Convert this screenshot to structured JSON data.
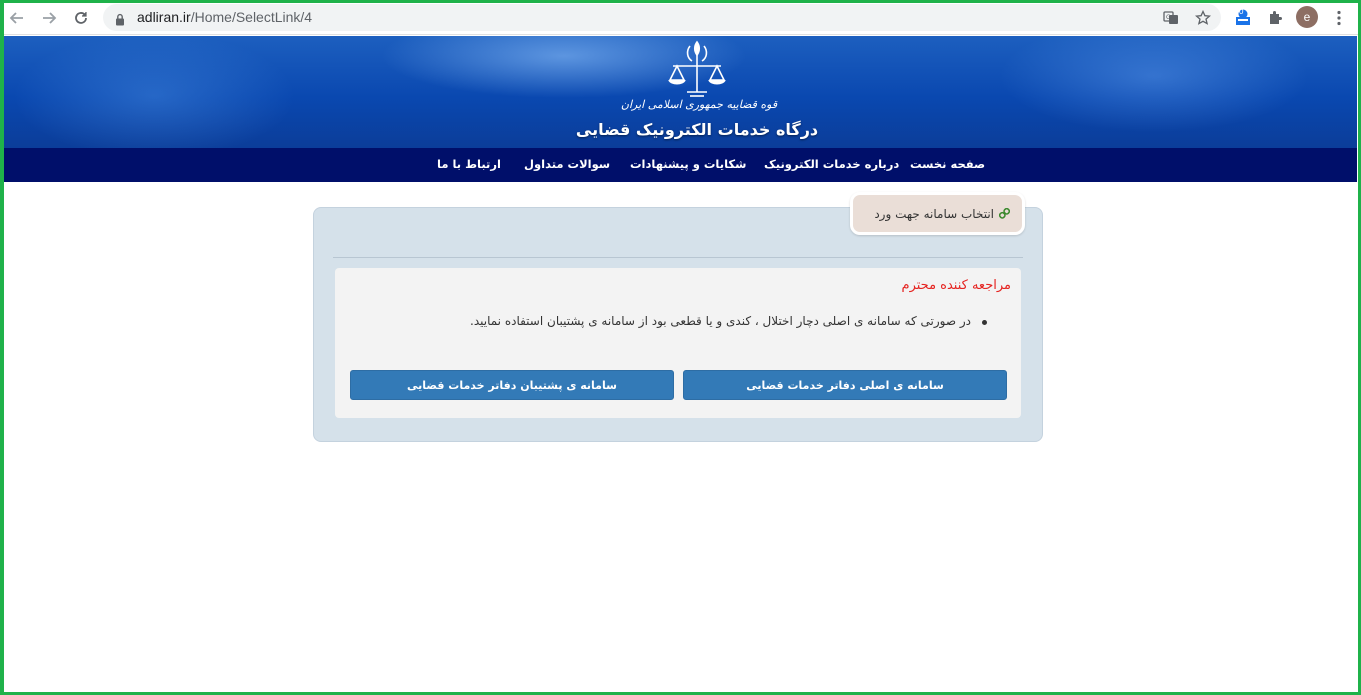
{
  "browser": {
    "url_domain": "adliran.ir",
    "url_path": "/Home/SelectLink/4",
    "profile_initial": "e",
    "extension_badge": "0",
    "icons": [
      "back-icon",
      "forward-icon",
      "reload-icon",
      "lock-icon",
      "translate-icon",
      "star-icon",
      "extension-badge-icon",
      "puzzle-icon",
      "menu-icon"
    ]
  },
  "header": {
    "motto": "قوه قضاییه جمهوری اسلامی ایران",
    "title": "درگاه خدمات الکترونیک قضایی"
  },
  "nav": {
    "items": [
      {
        "label": "صفحه نخست"
      },
      {
        "label": "درباره خدمات الکترونیک"
      },
      {
        "label": "شکایات و پیشنهادات"
      },
      {
        "label": "سوالات متداول"
      },
      {
        "label": "ارتباط با ما"
      }
    ]
  },
  "panel": {
    "tab_label": "انتخاب سامانه جهت ورد",
    "notice_title": "مراجعه کننده محترم",
    "notice_text": "در صورتی که سامانه ی اصلی دچار اختلال ، کندی و یا قطعی بود از سامانه ی پشتیبان استفاده نمایید.",
    "primary_button": "سامانه ی اصلی دفاتر خدمات قضایی",
    "backup_button": "سامانه ی پشتیبان دفاتر خدمات قضایی"
  },
  "colors": {
    "navbar": "#000f6a",
    "button": "#337ab7",
    "notice_title": "#e52421",
    "frame": "#1fb24a"
  }
}
